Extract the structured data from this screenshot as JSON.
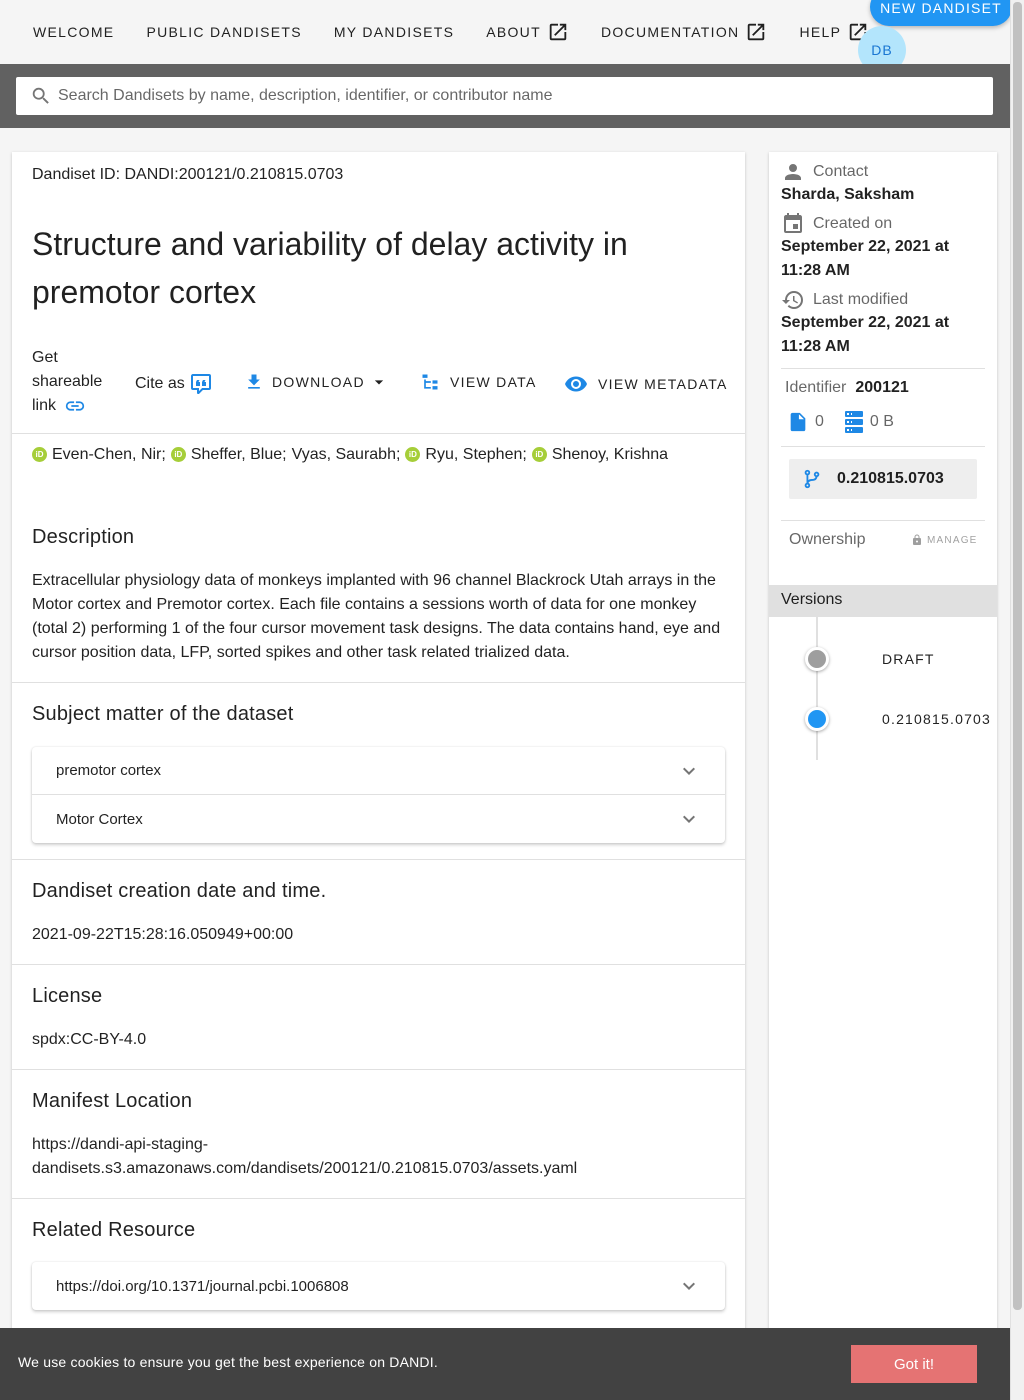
{
  "nav": {
    "welcome": "WELCOME",
    "public_dandisets": "PUBLIC DANDISETS",
    "my_dandisets": "MY DANDISETS",
    "about": "ABOUT",
    "documentation": "DOCUMENTATION",
    "help": "HELP",
    "new_dandiset": "NEW DANDISET",
    "avatar_initials": "DB",
    "external_icon": "open-in-new-icon"
  },
  "search": {
    "placeholder": "Search Dandisets by name, description, identifier, or contributor name",
    "icon": "magnify-icon"
  },
  "dandiset": {
    "id_text": "Dandiset ID: DANDI:200121/0.210815.0703",
    "title": "Structure and variability of delay activity in premotor cortex"
  },
  "actions": {
    "share_line1": "Get",
    "share_line2": "shareable",
    "share_line3": "link",
    "cite_as": "Cite as",
    "download": "DOWNLOAD",
    "view_data": "VIEW DATA",
    "view_metadata": "VIEW METADATA"
  },
  "contributors": [
    {
      "name": "Even-Chen, Nir;",
      "orcid": true
    },
    {
      "name": "Sheffer, Blue;",
      "orcid": true
    },
    {
      "name": "Vyas, Saurabh;",
      "orcid": false
    },
    {
      "name": "Ryu, Stephen;",
      "orcid": true
    },
    {
      "name": "Shenoy, Krishna",
      "orcid": true
    }
  ],
  "orcid_badge": "iD",
  "sections": {
    "description_title": "Description",
    "description_text": "Extracellular physiology data of monkeys implanted with 96 channel Blackrock Utah arrays in the Motor cortex and Premotor cortex. Each file contains a sessions worth of data for one monkey (total 2) performing 1 of the four cursor movement task designs. The data contains hand, eye and cursor position data, LFP, sorted spikes and other task related trialized data.",
    "subject_title": "Subject matter of the dataset",
    "subject_items": [
      "premotor cortex",
      "Motor Cortex"
    ],
    "creation_title": "Dandiset creation date and time.",
    "creation_value": "2021-09-22T15:28:16.050949+00:00",
    "license_title": "License",
    "license_value": "spdx:CC-BY-4.0",
    "manifest_title": "Manifest Location",
    "manifest_line1": "https://dandi-api-staging-",
    "manifest_line2": "dandisets.s3.amazonaws.com/dandisets/200121/0.210815.0703/assets.yaml",
    "related_title": "Related Resource",
    "related_items": [
      "https://doi.org/10.1371/journal.pcbi.1006808"
    ]
  },
  "sidebar": {
    "contact_label": "Contact",
    "contact_value": "Sharda, Saksham",
    "created_label": "Created on",
    "created_value_line1": "September 22, 2021 at",
    "created_value_line2": "11:28 AM",
    "modified_label": "Last modified",
    "modified_value_line1": "September 22, 2021 at",
    "modified_value_line2": "11:28 AM",
    "identifier_label": "Identifier",
    "identifier_value": "200121",
    "file_count": "0",
    "size": "0 B",
    "version": "0.210815.0703",
    "ownership_label": "Ownership",
    "manage_label": "MANAGE",
    "versions_title": "Versions",
    "versions": [
      {
        "label": "DRAFT",
        "color": "#9e9e9e"
      },
      {
        "label": "0.210815.0703",
        "color": "#2196f3"
      }
    ]
  },
  "cookie": {
    "text": "We use cookies to ensure you get the best experience on DANDI.",
    "button": "Got it!"
  },
  "colors": {
    "primary": "#2196f3",
    "icon_blue": "#1e88e5",
    "cookie_bg": "#424242",
    "cookie_button": "#e57373"
  }
}
